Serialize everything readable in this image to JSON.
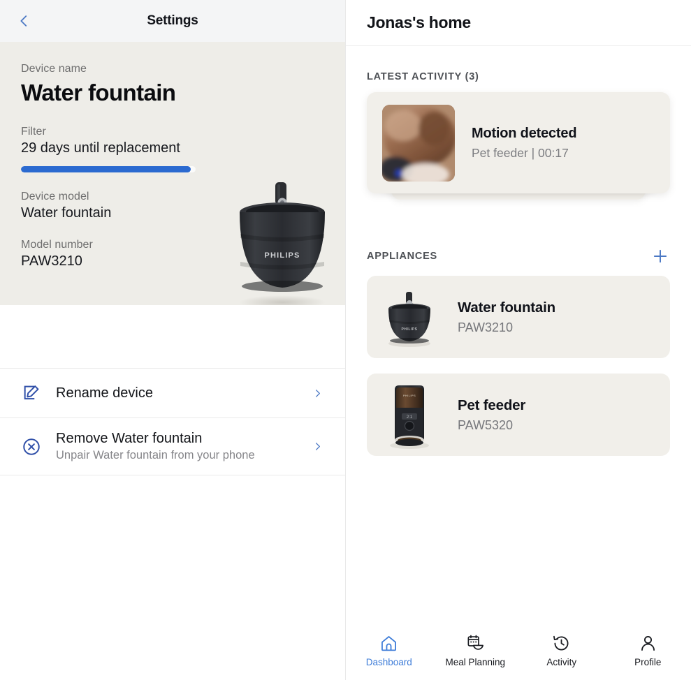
{
  "colors": {
    "accent_blue": "#3d7cd8",
    "progress_blue": "#2b6ad0",
    "icon_navy": "#2f4fa8",
    "beige_panel": "#eeede8",
    "card_beige": "#f1efea",
    "header_gray": "#f4f5f6",
    "text_dark": "#11131a",
    "text_muted": "#7b7c80"
  },
  "settings": {
    "back_icon": "chevron-left-icon",
    "title": "Settings",
    "device_name_label": "Device name",
    "device_name_value": "Water fountain",
    "filter_label": "Filter",
    "filter_value": "29 days until replacement",
    "filter_progress_percent": 97,
    "device_model_label": "Device model",
    "device_model_value": "Water fountain",
    "model_number_label": "Model number",
    "model_number_value": "PAW3210",
    "product_image_alt": "Philips water fountain",
    "product_brand": "PHILIPS",
    "actions": [
      {
        "icon": "edit-pencil-square-icon",
        "title": "Rename device",
        "subtitle": "",
        "chevron": "chevron-right-icon"
      },
      {
        "icon": "remove-circle-x-icon",
        "title": "Remove Water fountain",
        "subtitle": "Unpair Water fountain from your phone",
        "chevron": "chevron-right-icon"
      }
    ]
  },
  "dashboard": {
    "home_title": "Jonas's home",
    "latest_activity": {
      "section_title": "LATEST ACTIVITY (3)",
      "count": 3,
      "cards": [
        {
          "thumb_alt": "blurry pet camera snapshot",
          "title": "Motion detected",
          "source": "Pet feeder",
          "separator": "|",
          "time": "00:17",
          "subtitle": "Pet feeder | 00:17"
        }
      ]
    },
    "appliances": {
      "section_title": "APPLIANCES",
      "add_icon": "plus-icon",
      "items": [
        {
          "name": "Water fountain",
          "model": "PAW3210",
          "image_alt": "black Philips water fountain"
        },
        {
          "name": "Pet feeder",
          "model": "PAW5320",
          "image_alt": "black Philips pet feeder"
        }
      ]
    },
    "bottom_nav": [
      {
        "icon": "home-icon",
        "label": "Dashboard",
        "active": true
      },
      {
        "icon": "meal-plan-icon",
        "label": "Meal Planning",
        "active": false
      },
      {
        "icon": "clock-history-icon",
        "label": "Activity",
        "active": false
      },
      {
        "icon": "person-icon",
        "label": "Profile",
        "active": false
      }
    ]
  }
}
